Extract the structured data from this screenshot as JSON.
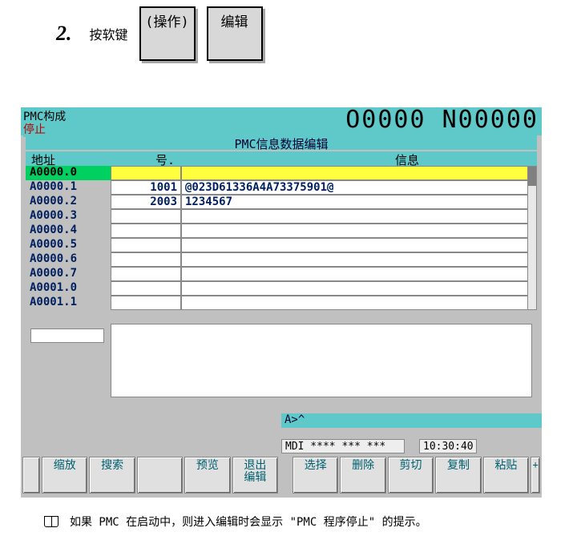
{
  "step": {
    "num": "2.",
    "text": "按软键",
    "btn1": "(操作)",
    "btn2": "编辑"
  },
  "screen": {
    "pmc_title": "PMC构成",
    "stop": "停止",
    "big_num": "O0000 N00000",
    "sub_title": "PMC信息数据编辑",
    "headers": {
      "addr": "地址",
      "no": "号.",
      "info": "信息"
    },
    "rows": [
      {
        "addr": "A0000.0",
        "no": "",
        "info": "",
        "sel": true
      },
      {
        "addr": "A0000.1",
        "no": "1001",
        "info": "@023D61336A4A73375901@"
      },
      {
        "addr": "A0000.2",
        "no": "2003",
        "info": " 1234567"
      },
      {
        "addr": "A0000.3",
        "no": "",
        "info": ""
      },
      {
        "addr": "A0000.4",
        "no": "",
        "info": ""
      },
      {
        "addr": "A0000.5",
        "no": "",
        "info": ""
      },
      {
        "addr": "A0000.6",
        "no": "",
        "info": ""
      },
      {
        "addr": "A0000.7",
        "no": "",
        "info": ""
      },
      {
        "addr": "A0001.0",
        "no": "",
        "info": ""
      },
      {
        "addr": "A0001.1",
        "no": "",
        "info": ""
      }
    ],
    "cmd_line": "A>^",
    "status": {
      "mdi": "MDI  **** *** ***",
      "time": "10:30:40"
    },
    "softkeys_left": [
      "缩放",
      "搜索",
      "",
      "预览"
    ],
    "softkey_exit_l1": "退出",
    "softkey_exit_l2": "编辑",
    "softkeys_right": [
      "选择",
      "删除",
      "剪切",
      "复制",
      "粘贴"
    ],
    "plus": "+"
  },
  "note": "如果 PMC 在启动中，则进入编辑时会显示 \"PMC 程序停止\" 的提示。"
}
